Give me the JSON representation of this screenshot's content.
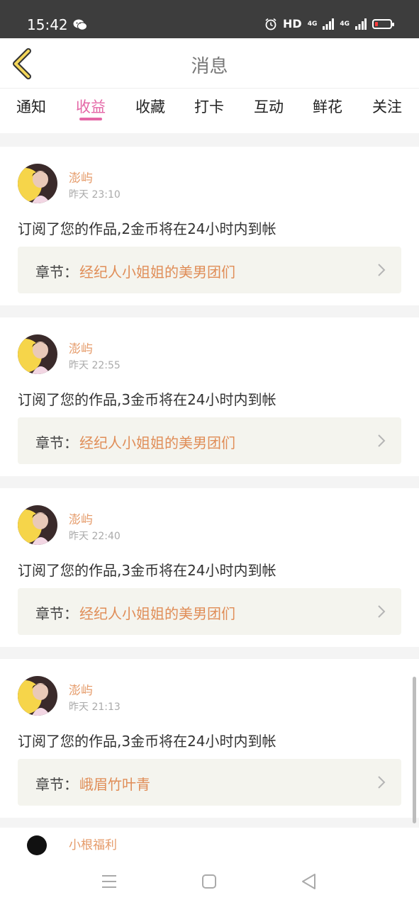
{
  "status_bar": {
    "time": "15:42",
    "hd": "HD",
    "network_1": "4G",
    "network_2": "4G"
  },
  "header": {
    "title": "消息"
  },
  "tabs": [
    {
      "label": "通知",
      "active": false
    },
    {
      "label": "收益",
      "active": true
    },
    {
      "label": "收藏",
      "active": false
    },
    {
      "label": "打卡",
      "active": false
    },
    {
      "label": "互动",
      "active": false
    },
    {
      "label": "鲜花",
      "active": false
    },
    {
      "label": "关注",
      "active": false
    }
  ],
  "cards": [
    {
      "user": "澎屿",
      "time": "昨天 23:10",
      "message": "订阅了您的作品,2金币将在24小时内到帐",
      "chapter_label": "章节：",
      "chapter": "经纪人小姐姐的美男团们"
    },
    {
      "user": "澎屿",
      "time": "昨天 22:55",
      "message": "订阅了您的作品,3金币将在24小时内到帐",
      "chapter_label": "章节：",
      "chapter": "经纪人小姐姐的美男团们"
    },
    {
      "user": "澎屿",
      "time": "昨天 22:40",
      "message": "订阅了您的作品,3金币将在24小时内到帐",
      "chapter_label": "章节：",
      "chapter": "经纪人小姐姐的美男团们"
    },
    {
      "user": "澎屿",
      "time": "昨天 21:13",
      "message": "订阅了您的作品,3金币将在24小时内到帐",
      "chapter_label": "章节：",
      "chapter": "峨眉竹叶青"
    }
  ],
  "partial_card": {
    "user": "小根福利"
  },
  "colors": {
    "accent": "#e466a6",
    "name": "#e59a68",
    "chapter": "#e08d57"
  },
  "icons": {
    "back": "back-chevron-icon",
    "chevron": "chevron-right-icon",
    "nav_menu": "menu-icon",
    "nav_home": "home-square-icon",
    "nav_back": "back-triangle-icon"
  }
}
